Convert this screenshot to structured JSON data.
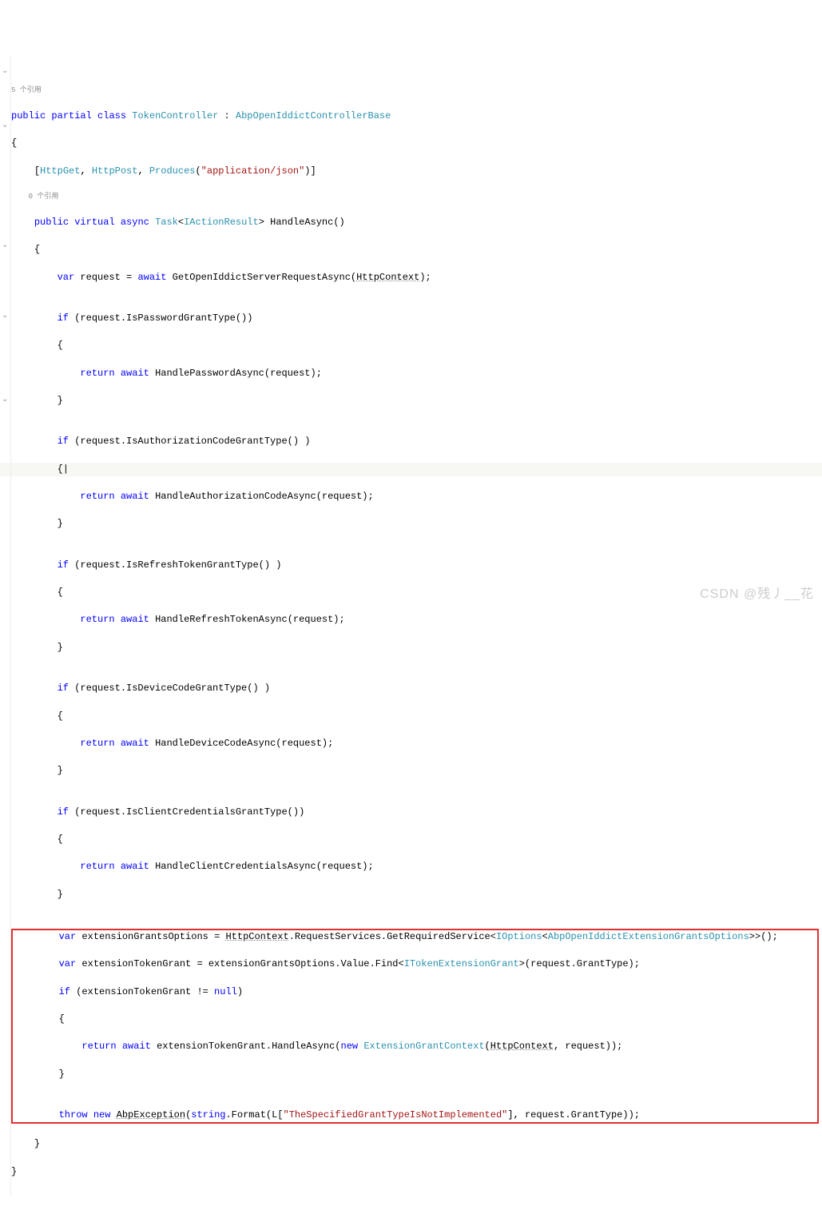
{
  "gray_refs_top": "5 个引用",
  "gray_refs_inner": "0 个引用",
  "l1": {
    "public": "public",
    "partial": "partial",
    "class": "class",
    "name": "TokenController",
    "colon": ":",
    "base": "AbpOpenIddictControllerBase"
  },
  "attrs": {
    "open": "[",
    "close": "]",
    "get": "HttpGet",
    "post": "HttpPost",
    "prod": "Produces",
    "lp": "(",
    "rp": ")",
    "arg": "\"application/json\"",
    "comma": ", "
  },
  "sig": {
    "public": "public",
    "virtual": "virtual",
    "async": "async",
    "task": "Task",
    "lt": "<",
    "gt": ">",
    "iar": "IActionResult",
    "method": "HandleAsync()"
  },
  "r1": {
    "var": "var",
    "name": "request",
    "eq": "=",
    "await": "await",
    "call": "GetOpenIddictServerRequestAsync(",
    "hc": "HttpContext",
    "end": ");"
  },
  "if_pw": {
    "if": "if",
    "cond": "(request.IsPasswordGrantType())"
  },
  "ret_pw": {
    "return": "return",
    "await": "await",
    "call": "HandlePasswordAsync(request);"
  },
  "if_ac": {
    "if": "if",
    "cond": "(request.IsAuthorizationCodeGrantType() )"
  },
  "ret_ac": {
    "return": "return",
    "await": "await",
    "call": "HandleAuthorizationCodeAsync(request);"
  },
  "if_rt": {
    "if": "if",
    "cond": "(request.IsRefreshTokenGrantType() )"
  },
  "ret_rt": {
    "return": "return",
    "await": "await",
    "call": "HandleRefreshTokenAsync(request);"
  },
  "if_dc": {
    "if": "if",
    "cond": "(request.IsDeviceCodeGrantType() )"
  },
  "ret_dc": {
    "return": "return",
    "await": "await",
    "call": "HandleDeviceCodeAsync(request);"
  },
  "if_cc": {
    "if": "if",
    "cond": "(request.IsClientCredentialsGrantType())"
  },
  "ret_cc": {
    "return": "return",
    "await": "await",
    "call": "HandleClientCredentialsAsync(request);"
  },
  "box": {
    "l1": {
      "var": "var",
      "name": "extensionGrantsOptions",
      "eq": "=",
      "hc": "HttpContext",
      "mid": ".RequestServices.GetRequiredService<",
      "iopt": "IOptions",
      "lt": "<",
      "abp": "AbpOpenIddictExtensionGrantsOptions",
      "gt": ">>();",
      "gt0": ">"
    },
    "l2": {
      "var": "var",
      "name": "extensionTokenGrant",
      "eq": "=",
      "pre": "extensionGrantsOptions.Value.Find<",
      "itg": "ITokenExtensionGrant",
      "post": ">(request.GrantType);"
    },
    "l3": {
      "if": "if",
      "cond": "(extensionTokenGrant != ",
      "null": "null",
      "rp": ")"
    },
    "l4": {
      "return": "return",
      "await": "await",
      "call": "extensionTokenGrant.HandleAsync(",
      "new": "new",
      "egc": "ExtensionGrantContext",
      "lp": "(",
      "hc": "HttpContext",
      "post": ", request));"
    },
    "l5": {
      "throw": "throw",
      "new": "new",
      "ex": "AbpException",
      "lp": "(",
      "sf": "string",
      "fmt": ".Format(L[",
      "str": "\"TheSpecifiedGrantTypeIsNotImplemented\"",
      "post": "], request.GrantType));"
    }
  },
  "braces": {
    "o": "{",
    "c": "}",
    "ob": "{|"
  },
  "watermark": "CSDN @残丿__花"
}
